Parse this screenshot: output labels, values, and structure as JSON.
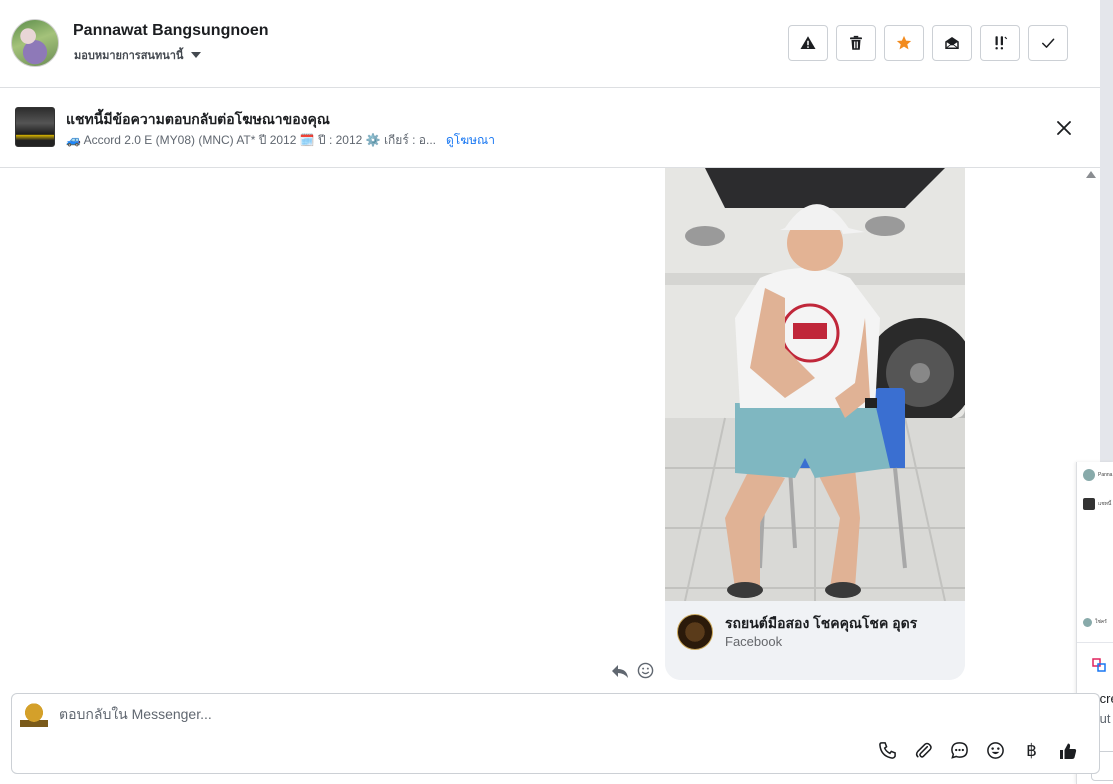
{
  "header": {
    "name": "Pannawat Bangsungnoen",
    "assign_label": "มอบหมายการสนทนานี้",
    "toolbar": [
      {
        "icon": "warning-icon",
        "color": "#1c1e21"
      },
      {
        "icon": "trash-icon",
        "color": "#1c1e21"
      },
      {
        "icon": "star-icon",
        "color": "#f28b1e"
      },
      {
        "icon": "mail-open-icon",
        "color": "#1c1e21"
      },
      {
        "icon": "follow-up-icon",
        "color": "#1c1e21"
      },
      {
        "icon": "checkmark-icon",
        "color": "#1c1e21"
      }
    ]
  },
  "ad_banner": {
    "title": "แชทนี้มีข้อความตอบกลับต่อโฆษณาของคุณ",
    "subtitle": "🚙 Accord 2.0 E (MY08) (MNC) AT* ปี 2012 🗓️ ปี : 2012 ⚙️ เกียร์ : อ...",
    "link_label": "ดูโฆษณา"
  },
  "shared_post": {
    "page_name": "รถยนต์มือสอง โชคคุณโชค อุดร",
    "source": "Facebook"
  },
  "side_panel": {
    "item_1": "Panna",
    "item_2": "แชทนี้",
    "item_3": "ใช่ครั",
    "bottom_text_1": "Scre",
    "bottom_text_2": "Aut"
  },
  "composer": {
    "placeholder": "ตอบกลับใน Messenger...",
    "value": "",
    "tools": [
      "phone-icon",
      "attachment-icon",
      "saved-reply-icon",
      "emoji-icon",
      "baht-icon",
      "thumbs-up-icon"
    ],
    "baht_symbol": "฿"
  },
  "colors": {
    "accent_link": "#1877f2",
    "star": "#f28b1e",
    "card_bg": "#f0f2f5"
  }
}
